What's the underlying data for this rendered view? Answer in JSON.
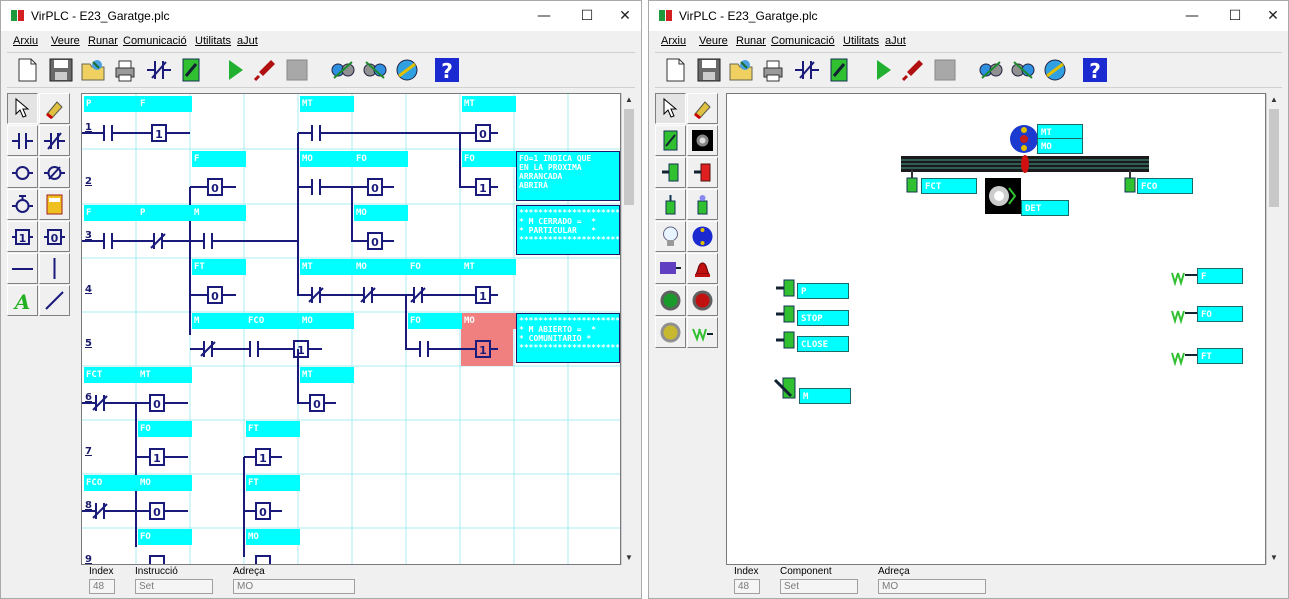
{
  "left_window": {
    "title": "VirPLC - E23_Garatge.plc",
    "menu": [
      "Arxiu",
      "Veure",
      "Runar",
      "Comunicació",
      "Utilitats",
      "aJut"
    ],
    "status": {
      "index_label": "Index",
      "index_value": "48",
      "second_label": "Instrucció",
      "second_value": "Set",
      "address_label": "Adreça",
      "address_value": "MO"
    }
  },
  "right_window": {
    "title": "VirPLC - E23_Garatge.plc",
    "menu": [
      "Arxiu",
      "Veure",
      "Runar",
      "Comunicació",
      "Utilitats",
      "aJut"
    ],
    "status": {
      "index_label": "Index",
      "index_value": "48",
      "second_label": "Component",
      "second_value": "Set",
      "address_label": "Adreça",
      "address_value": "MO"
    }
  },
  "window_buttons": {
    "minimize": "—",
    "maximize": "☐",
    "close": "✕"
  },
  "ladder": {
    "row_numbers": [
      "1",
      "2",
      "3",
      "4",
      "5",
      "6",
      "7",
      "8",
      "9"
    ],
    "labels": {
      "r1_p": "P",
      "r1_f": "F",
      "r1_mt": "MT",
      "r1_mt2": "MT",
      "r2_f": "F",
      "r2_mo": "MO",
      "r2_fo": "FO",
      "r2_fo2": "FO",
      "r3_f": "F",
      "r3_p": "P",
      "r3_m": "M",
      "r3_mo": "MO",
      "r4_ft": "FT",
      "r4_mt": "MT",
      "r4_mo": "MO",
      "r4_fo": "FO",
      "r4_mt2": "MT",
      "r5_m": "M",
      "r5_fco": "FCO",
      "r5_mo": "MO",
      "r5_fo": "FO",
      "r5_mo2": "MO",
      "r6_fct": "FCT",
      "r6_mt": "MT",
      "r6_mt2": "MT",
      "r7_fo": "FO",
      "r7_ft": "FT",
      "r8_fco": "FCO",
      "r8_mo": "MO",
      "r8_ft": "FT",
      "r9_fo": "FO",
      "r9_mo": "MO"
    },
    "comments": {
      "c1": "FO=1 INDICA QUE\nEN LA PROXIMA\nARRANCADA\nABRIRÁ",
      "c2": "*********************\n* M CERRADO =  *\n* PARTICULAR   *\n*********************",
      "c3": "*********************\n* M ABIERTO =  *\n* COMUNITARIO *\n*********************"
    }
  },
  "simulation": {
    "labels": {
      "mt": "MT",
      "mo": "MO",
      "fct": "FCT",
      "fco": "FCO",
      "det": "DET",
      "p": "P",
      "stop": "STOP",
      "close": "CLOSE",
      "m": "M",
      "f": "F",
      "fo": "FO",
      "ft": "FT"
    }
  },
  "colors": {
    "label_bg": "#00ffff",
    "ladder_line": "#1a1a7a",
    "grid": "#a8ecf0",
    "active_cell": "#f08080"
  },
  "icons": {
    "toolbar": [
      "new-file-icon",
      "save-icon",
      "open-icon",
      "print-icon",
      "contact-mode-icon",
      "switch-mode-icon",
      "run-icon",
      "stop-plc-icon",
      "pause-icon",
      "comm-upload-icon",
      "comm-download-icon",
      "monitor-icon",
      "help-icon"
    ]
  }
}
